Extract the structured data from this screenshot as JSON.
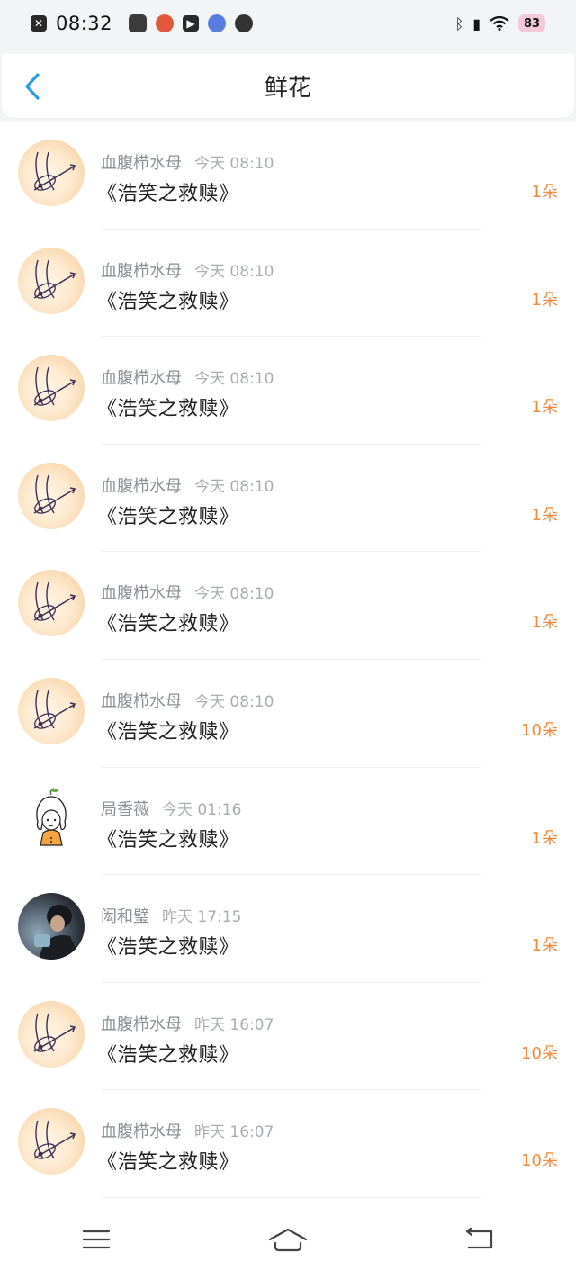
{
  "status_bar": {
    "time": "08:32",
    "battery": "83",
    "icons": [
      "close-square-icon",
      "app-icon-1",
      "app-icon-2",
      "play-icon",
      "app-icon-3",
      "app-icon-4",
      "bluetooth-icon",
      "vibrate-icon",
      "wifi-icon",
      "battery-icon"
    ]
  },
  "header": {
    "title": "鲜花",
    "back_icon": "chevron-left-icon"
  },
  "colors": {
    "accent": "#2a9be6",
    "amount": "#f08a3d",
    "muted": "#8a8f96"
  },
  "list": {
    "items": [
      {
        "user": "血腹栉水母",
        "time": "今天  08:10",
        "book": "《浩笑之救赎》",
        "amount": "1朵",
        "avatar": "signature"
      },
      {
        "user": "血腹栉水母",
        "time": "今天  08:10",
        "book": "《浩笑之救赎》",
        "amount": "1朵",
        "avatar": "signature"
      },
      {
        "user": "血腹栉水母",
        "time": "今天  08:10",
        "book": "《浩笑之救赎》",
        "amount": "1朵",
        "avatar": "signature"
      },
      {
        "user": "血腹栉水母",
        "time": "今天  08:10",
        "book": "《浩笑之救赎》",
        "amount": "1朵",
        "avatar": "signature"
      },
      {
        "user": "血腹栉水母",
        "time": "今天  08:10",
        "book": "《浩笑之救赎》",
        "amount": "1朵",
        "avatar": "signature"
      },
      {
        "user": "血腹栉水母",
        "time": "今天  08:10",
        "book": "《浩笑之救赎》",
        "amount": "10朵",
        "avatar": "signature"
      },
      {
        "user": "局香薇",
        "time": "今天  01:16",
        "book": "《浩笑之救赎》",
        "amount": "1朵",
        "avatar": "girl"
      },
      {
        "user": "闳和璧",
        "time": "昨天  17:15",
        "book": "《浩笑之救赎》",
        "amount": "1朵",
        "avatar": "photo"
      },
      {
        "user": "血腹栉水母",
        "time": "昨天  16:07",
        "book": "《浩笑之救赎》",
        "amount": "10朵",
        "avatar": "signature"
      },
      {
        "user": "血腹栉水母",
        "time": "昨天  16:07",
        "book": "《浩笑之救赎》",
        "amount": "10朵",
        "avatar": "signature"
      }
    ]
  },
  "nav_bar": {
    "icons": [
      "menu-icon",
      "home-icon",
      "back-icon"
    ]
  }
}
